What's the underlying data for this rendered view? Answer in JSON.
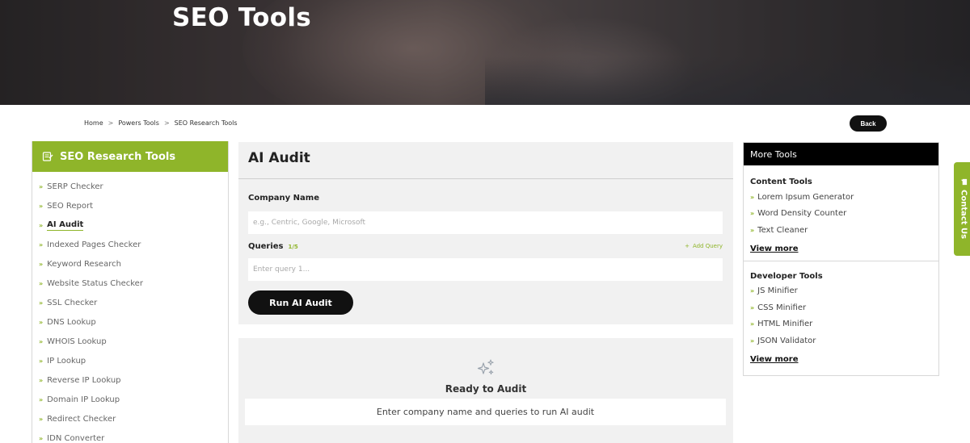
{
  "hero": {
    "title": "SEO Tools"
  },
  "breadcrumb": {
    "items": [
      "Home",
      "Powers Tools",
      "SEO Research Tools"
    ],
    "separator": ">"
  },
  "back_button": {
    "label": "Back"
  },
  "sidebar": {
    "title": "SEO Research Tools",
    "icon": "report-icon",
    "items": [
      {
        "label": "SERP Checker",
        "active": false
      },
      {
        "label": "SEO Report",
        "active": false
      },
      {
        "label": "AI Audit",
        "active": true
      },
      {
        "label": "Indexed Pages Checker",
        "active": false
      },
      {
        "label": "Keyword Research",
        "active": false
      },
      {
        "label": "Website Status Checker",
        "active": false
      },
      {
        "label": "SSL Checker",
        "active": false
      },
      {
        "label": "DNS Lookup",
        "active": false
      },
      {
        "label": "WHOIS Lookup",
        "active": false
      },
      {
        "label": "IP Lookup",
        "active": false
      },
      {
        "label": "Reverse IP Lookup",
        "active": false
      },
      {
        "label": "Domain IP Lookup",
        "active": false
      },
      {
        "label": "Redirect Checker",
        "active": false
      },
      {
        "label": "IDN Converter",
        "active": false
      }
    ],
    "bullet": "»"
  },
  "main": {
    "title": "AI Audit",
    "company": {
      "label": "Company Name",
      "placeholder": "e.g., Centric, Google, Microsoft",
      "value": ""
    },
    "queries": {
      "label": "Queries",
      "count": "1/5",
      "add_label": "Add Query",
      "add_icon": "+",
      "placeholder": "Enter query 1...",
      "value": ""
    },
    "run_button": "Run AI Audit"
  },
  "result": {
    "icon": "sparkle-icon",
    "title": "Ready to Audit",
    "message": "Enter company name and queries to run AI audit"
  },
  "more_tools": {
    "title": "More Tools",
    "sections": [
      {
        "heading": "Content Tools",
        "items": [
          "Lorem Ipsum Generator",
          "Word Density Counter",
          "Text Cleaner"
        ],
        "more": "View more"
      },
      {
        "heading": "Developer Tools",
        "items": [
          "JS Minifier",
          "CSS Minifier",
          "HTML Minifier",
          "JSON Validator"
        ],
        "more": "View more"
      }
    ]
  },
  "contact_tab": {
    "label": "Contact Us",
    "icon": "chat-icon"
  },
  "colors": {
    "accent": "#8fb52a",
    "dark": "#111111",
    "panel": "#f1f1f1"
  }
}
